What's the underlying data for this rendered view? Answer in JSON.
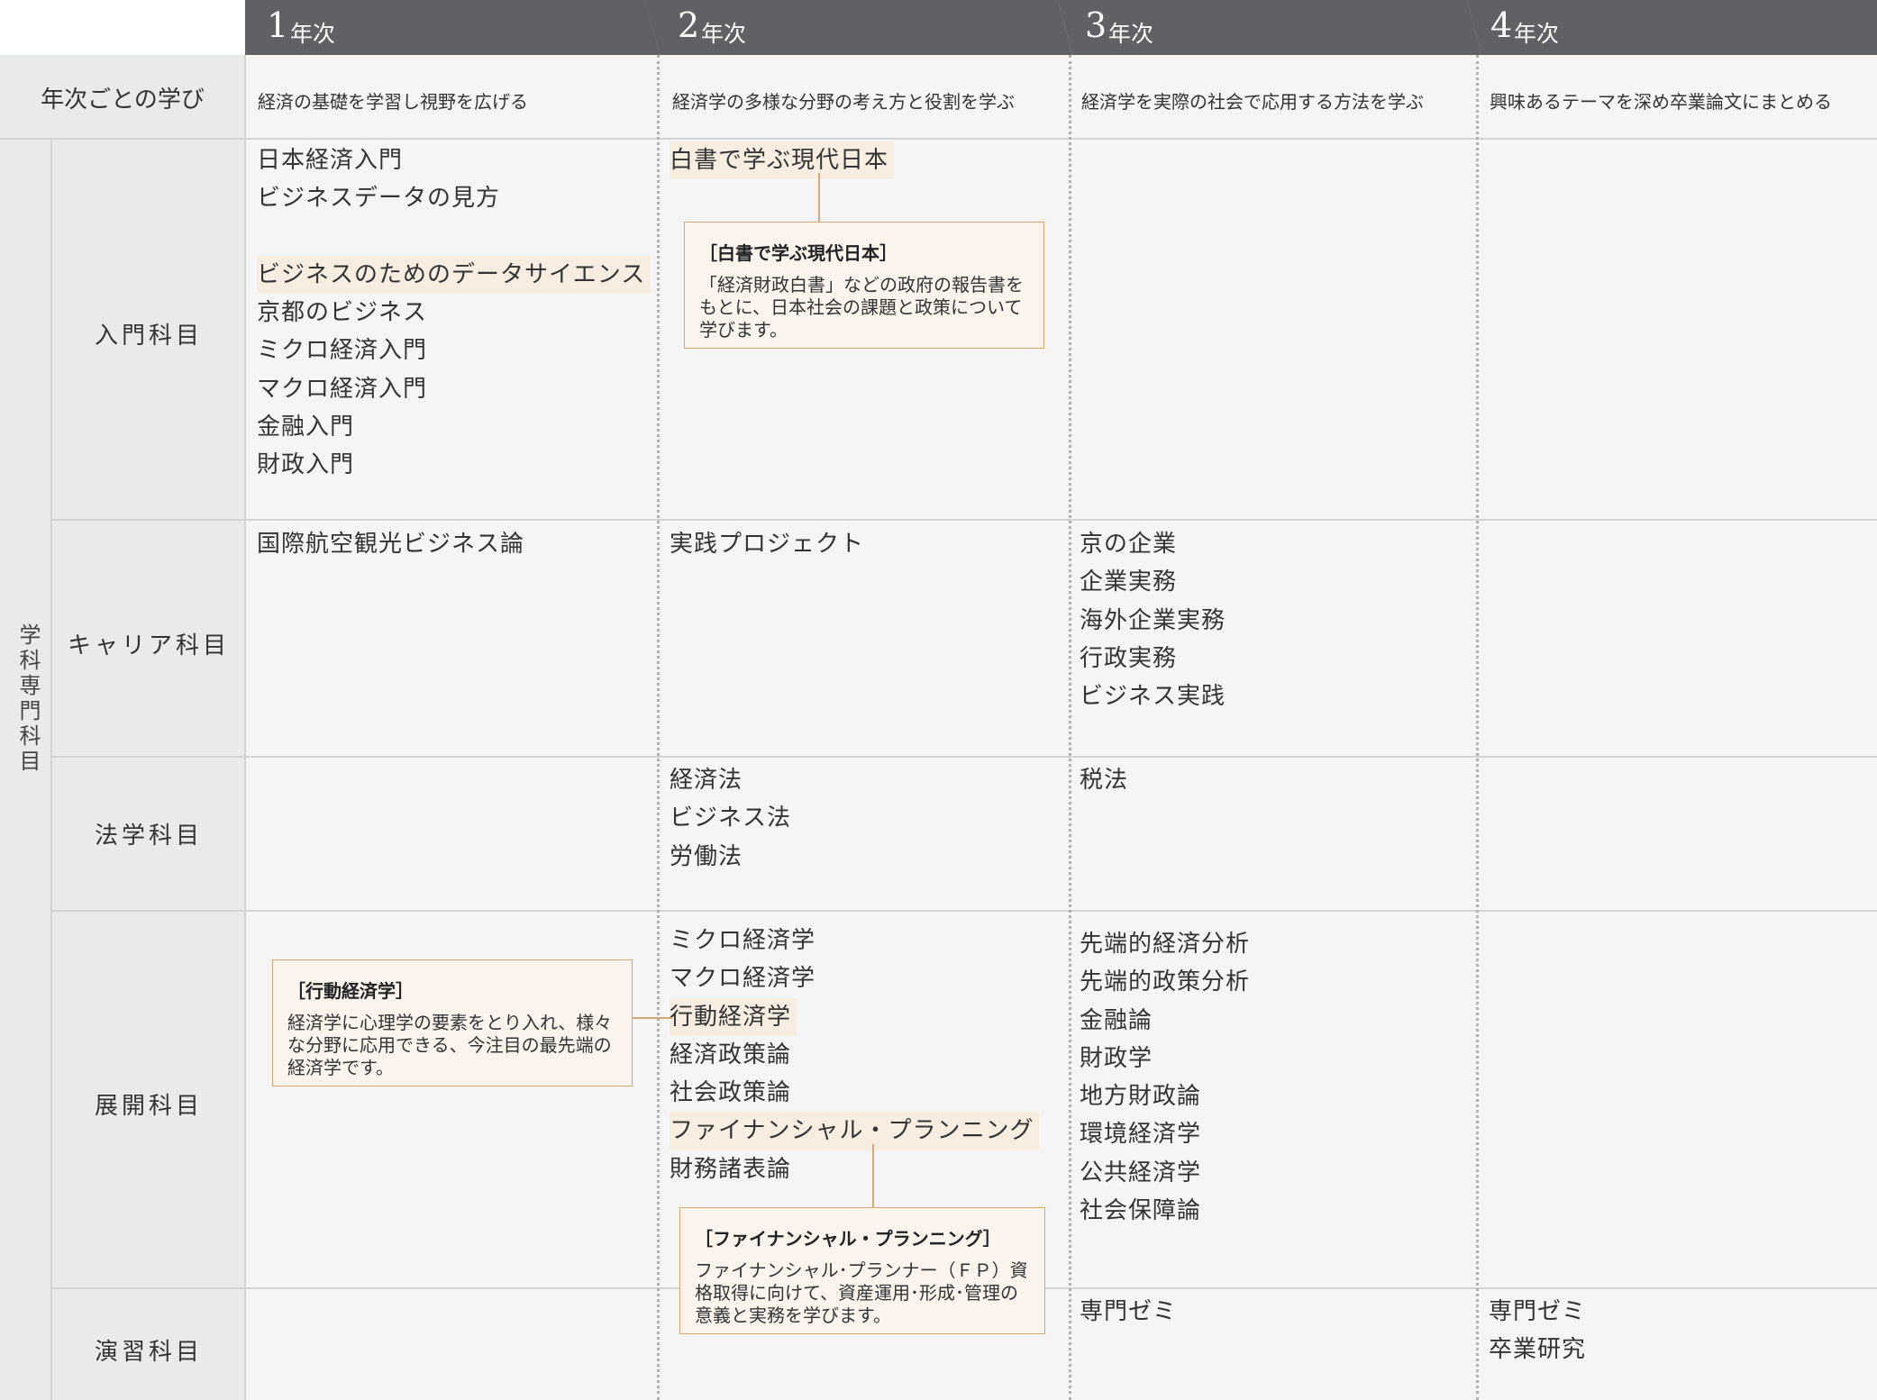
{
  "years": [
    {
      "num": "1",
      "suffix": "年次",
      "goal": "経済の基礎を学習し視野を広げる"
    },
    {
      "num": "2",
      "suffix": "年次",
      "goal": "経済学の多様な分野の考え方と役割を学ぶ"
    },
    {
      "num": "3",
      "suffix": "年次",
      "goal": "経済学を実際の社会で応用する方法を学ぶ"
    },
    {
      "num": "4",
      "suffix": "年次",
      "goal": "興味あるテーマを深め卒業論文にまとめる"
    }
  ],
  "row_label_goals": "年次ごとの学び",
  "category_label": "学科専門科目",
  "rows": [
    {
      "label": "入門科目",
      "cells": [
        [
          "日本経済入門",
          "ビジネスデータの見方",
          "",
          "ビジネスのためのデータサイエンス",
          "京都のビジネス",
          "ミクロ経済入門",
          "マクロ経済入門",
          "金融入門",
          "財政入門"
        ],
        [
          "白書で学ぶ現代日本"
        ],
        [],
        []
      ]
    },
    {
      "label": "キャリア科目",
      "cells": [
        [
          "国際航空観光ビジネス論"
        ],
        [
          "実践プロジェクト"
        ],
        [
          "京の企業",
          "企業実務",
          "海外企業実務",
          "行政実務",
          "ビジネス実践"
        ],
        []
      ]
    },
    {
      "label": "法学科目",
      "cells": [
        [],
        [
          "経済法",
          "ビジネス法",
          "労働法"
        ],
        [
          "税法"
        ],
        []
      ]
    },
    {
      "label": "展開科目",
      "cells": [
        [],
        [
          "ミクロ経済学",
          "マクロ経済学",
          "行動経済学",
          "経済政策論",
          "社会政策論",
          "ファイナンシャル・プランニング",
          "財務諸表論"
        ],
        [
          "先端的経済分析",
          "先端的政策分析",
          "金融論",
          "財政学",
          "地方財政論",
          "環境経済学",
          "公共経済学",
          "社会保障論"
        ],
        []
      ]
    },
    {
      "label": "演習科目",
      "cells": [
        [],
        [],
        [
          "専門ゼミ"
        ],
        [
          "専門ゼミ",
          "卒業研究"
        ]
      ]
    }
  ],
  "callouts": [
    {
      "title": "［白書で学ぶ現代日本］",
      "body": "「経済財政白書」などの政府の報告書をもとに、日本社会の課題と政策について学びます。"
    },
    {
      "title": "［行動経済学］",
      "body": "経済学に心理学の要素をとり入れ、様々な分野に応用できる、今注目の最先端の経済学です。"
    },
    {
      "title": "［ファイナンシャル・プランニング］",
      "body": "ファイナンシャル･プランナー（ＦＰ）資格取得に向けて、資産運用･形成･管理の意義と実務を学びます。"
    }
  ],
  "colors": {
    "header": "#606164",
    "callout_border": "#d8a874",
    "callout_bg": "#faf4ec",
    "highlight": "#f7ede1",
    "panel": "#f4f5f4",
    "label_bg": "#e9eaea"
  }
}
